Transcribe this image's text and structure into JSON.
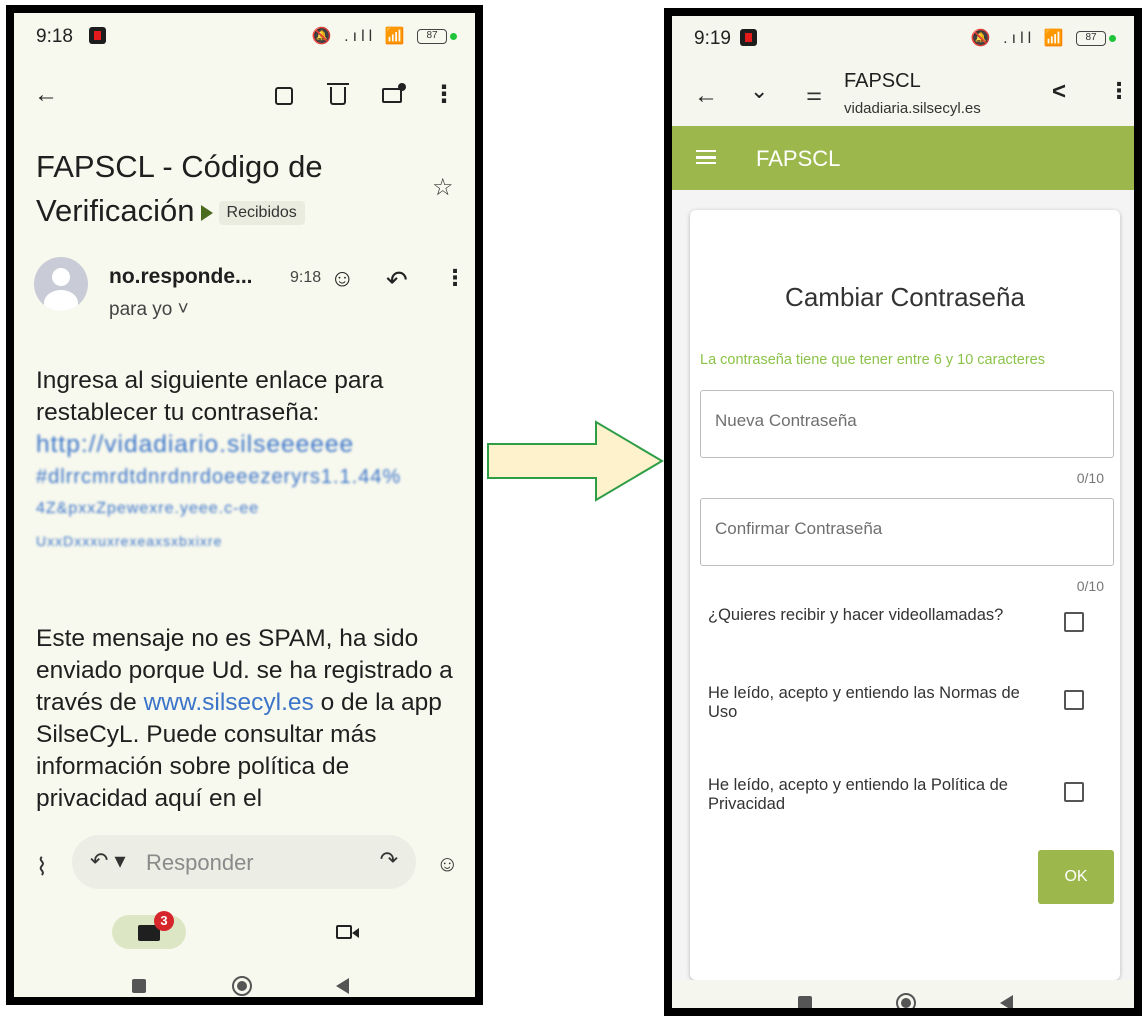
{
  "left": {
    "status": {
      "time": "9:18",
      "icons": "🔕 .ıll 📶",
      "battery": "87"
    },
    "toolbar": {
      "back": "←",
      "more": "⋮"
    },
    "subject_line1": "FAPSCL - Código de",
    "subject_line2": "Verificación",
    "label_chip": "Recibidos",
    "star": "☆",
    "sender": "no.responde...",
    "sender_time": "9:18",
    "to": "para yo ˅",
    "body": {
      "intro": "Ingresa al siguiente enlace para restablecer tu contraseña:",
      "link_line1": "http://vidadiario.silseeeeee",
      "link_line2": "#dlrrcmrdtdnrdnrdoeeezeryrs1.1.44%",
      "link_line3": "4Z&pxxZpewexre.yeee.c-ee",
      "link_line4": "UxxDxxxuxrexeaxsxbxixre",
      "p2_a": "Este mensaje no es SPAM, ha sido enviado porque Ud. se ha registrado a través de ",
      "p2_link": "www.silsecyl.es",
      "p2_b": " o de la app SilseCyL. Puede consultar más información sobre política de privacidad aquí en el"
    },
    "reply": {
      "placeholder": "Responder",
      "reply_icon": "↶ ▾",
      "forward_icon": "↷",
      "emoji_icon": "☺",
      "clip_icon": "⌇"
    },
    "tabs": {
      "mail_badge": "3"
    }
  },
  "right": {
    "status": {
      "time": "9:19",
      "icons": "🔕 .ıll 📶",
      "battery": "87"
    },
    "browser": {
      "title": "FAPSCL",
      "url": "vidadiaria.silsecyl.es"
    },
    "app_title": "FAPSCL",
    "card_title": "Cambiar Contraseña",
    "hint": "La contraseña tiene que tener entre 6 y 10 caracteres",
    "new_password": {
      "placeholder": "Nueva Contraseña",
      "counter": "0/10"
    },
    "confirm_password": {
      "placeholder": "Confirmar Contraseña",
      "counter": "0/10"
    },
    "checks": [
      "¿Quieres recibir y hacer videollamadas?",
      "He leído, acepto y entiendo las Normas de Uso",
      "He leído, acepto y entiendo la Política de Privacidad"
    ],
    "ok_label": "OK"
  },
  "colors": {
    "accent_green": "#9cb84c",
    "hint_green": "#8bc34a",
    "link_blue": "#3b74c9",
    "arrow_fill": "#fdf2cc",
    "arrow_stroke": "#2e9e46"
  }
}
